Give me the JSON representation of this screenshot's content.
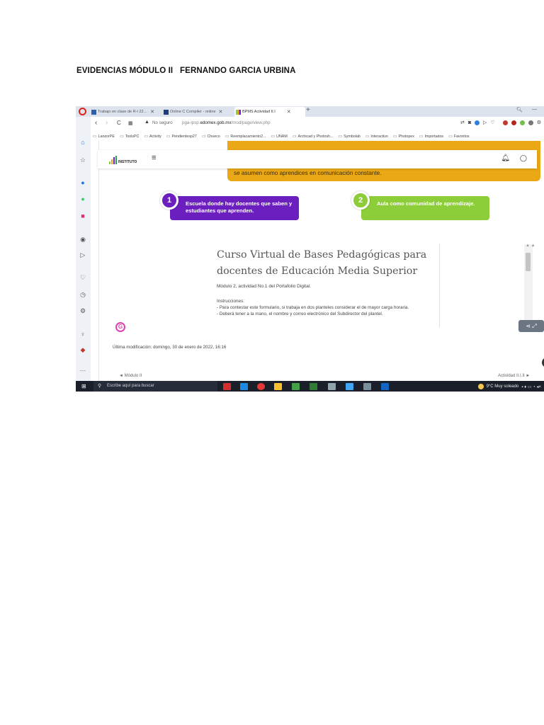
{
  "document": {
    "title": "EVIDENCIAS MÓDULO II   FERNANDO GARCIA URBINA"
  },
  "browser": {
    "tabs": [
      {
        "label": "Trabajo en clase de R-I 22…",
        "icon": "document-favicon"
      },
      {
        "label": "Online C Compiler - online",
        "icon": "compiler-favicon"
      },
      {
        "label": "BPMS Actividad II.I",
        "icon": "chart-favicon",
        "active": true
      }
    ],
    "new_tab": "+",
    "address": {
      "security": "No seguro",
      "url_prefix": "pga-ipsp.",
      "url_domain": "edomex.gob.mx",
      "url_path": "/mod/page/view.php"
    },
    "bookmarks": [
      "LanzorPE",
      "ToolsPC",
      "Activity",
      "Pendientesp27",
      "Chueco",
      "Reemplacamiento2...",
      "UNAM",
      "Archicad y Photosh...",
      "Symbolab",
      "Interactivo",
      "Photopex",
      "Importados",
      "Favoritos"
    ]
  },
  "page": {
    "banner_text": "se asumen como aprendices en comunicación constante.",
    "logo_text": "INSTITUTO",
    "card1": {
      "number": "1",
      "text": "Escuela donde hay docentes que saben y estudiantes que aprenden."
    },
    "card2": {
      "number": "2",
      "text": "Aula como comunidad de aprendizaje."
    },
    "form": {
      "title": "Curso Virtual de Bases Pedagógicas para docentes de Educación Media Superior",
      "subtitle": "Módulo 2, actividad No.1 del Portafolio Digital.",
      "instructions_heading": "Instrucciones:",
      "instruction1": "- Para contestar este formulario, si trabaja en dos planteles considerar el de mayor carga horaria.",
      "instruction2": "- Deberá tener a la mano, el nombre y correo electrónico del Subdirector del plantel."
    },
    "last_modified": "Última modificación: domingo, 30 de enero de 2022, 16:16",
    "nav_prev": "◄ Módulo II",
    "nav_next": "Actividad II.I.II ►"
  },
  "taskbar": {
    "search_placeholder": "Escribe aquí para buscar",
    "weather": "9°C  Muy soleado"
  },
  "colors": {
    "purple": "#6c1fbf",
    "green": "#8dcd3a",
    "yellow": "#eaa817"
  }
}
